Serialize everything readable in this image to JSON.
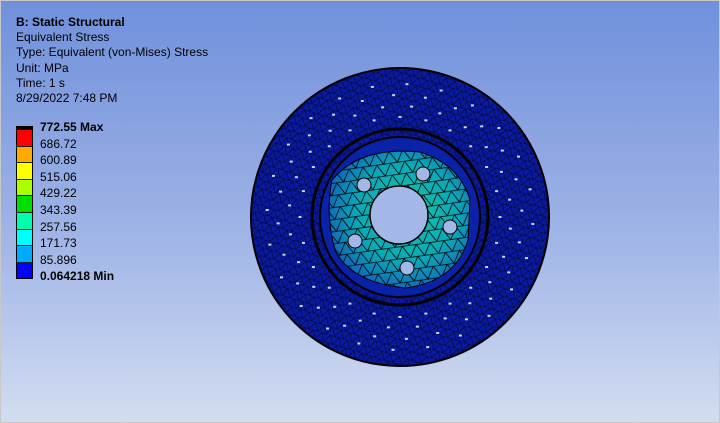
{
  "info": {
    "title": "B: Static Structural",
    "result": "Equivalent Stress",
    "type": "Type: Equivalent (von-Mises) Stress",
    "unit": "Unit: MPa",
    "time": "Time: 1 s",
    "date": "8/29/2022 7:48 PM"
  },
  "legend": {
    "labels": [
      "772.55 Max",
      "686.72",
      "600.89",
      "515.06",
      "429.22",
      "343.39",
      "257.56",
      "171.73",
      "85.896",
      "0.064218 Min"
    ],
    "colors": [
      "#ff0000",
      "#ffaa00",
      "#ffff00",
      "#aaff00",
      "#00dd00",
      "#00ffaa",
      "#00ffff",
      "#00aaff",
      "#0000ff"
    ]
  },
  "model": {
    "name": "brake-disc-stress-contour"
  }
}
